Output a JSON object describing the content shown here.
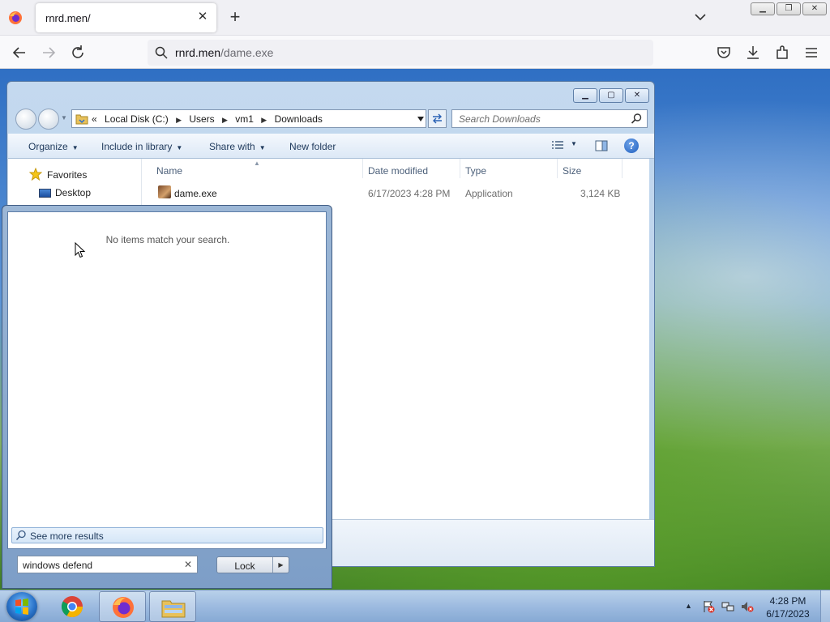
{
  "browser": {
    "tab_title": "rnrd.men/",
    "url_host": "rnrd.men",
    "url_path": "/dame.exe"
  },
  "explorer": {
    "breadcrumb": {
      "overflow": "«",
      "items": [
        "Local Disk (C:)",
        "Users",
        "vm1",
        "Downloads"
      ]
    },
    "search_placeholder": "Search Downloads",
    "commands": {
      "organize": "Organize",
      "include_in_library": "Include in library",
      "share_with": "Share with",
      "new_folder": "New folder"
    },
    "nav": {
      "favorites": "Favorites",
      "desktop": "Desktop"
    },
    "columns": {
      "name": "Name",
      "date_modified": "Date modified",
      "type": "Type",
      "size": "Size"
    },
    "files": [
      {
        "name": "dame.exe",
        "date_modified": "6/17/2023 4:28 PM",
        "type": "Application",
        "size": "3,124 KB"
      }
    ]
  },
  "start_menu": {
    "no_items": "No items match your search.",
    "see_more": "See more results",
    "search_value": "windows defend",
    "lock_label": "Lock"
  },
  "taskbar": {
    "time": "4:28 PM",
    "date": "6/17/2023"
  }
}
